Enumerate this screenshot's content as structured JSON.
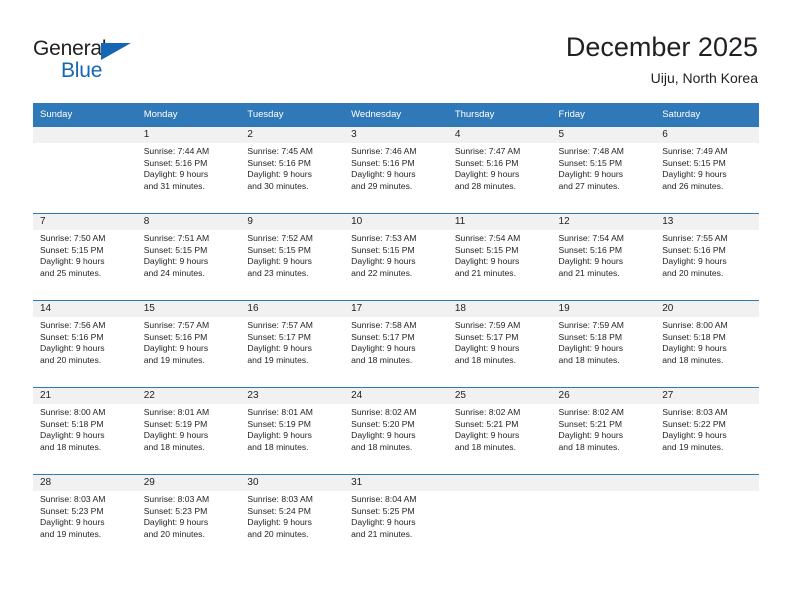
{
  "brand": {
    "name_part1": "General",
    "name_part2": "Blue",
    "accent_color": "#1567b5"
  },
  "header": {
    "title": "December 2025",
    "subtitle": "Uiju, North Korea"
  },
  "theme": {
    "header_row_color": "#3079b9",
    "daynum_band_color": "#f1f1f1",
    "text_color": "#231f20"
  },
  "weekday_headers": [
    "Sunday",
    "Monday",
    "Tuesday",
    "Wednesday",
    "Thursday",
    "Friday",
    "Saturday"
  ],
  "labels": {
    "sunrise_prefix": "Sunrise:",
    "sunset_prefix": "Sunset:",
    "daylight_prefix": "Daylight:"
  },
  "weeks": [
    [
      {
        "day": "",
        "sunrise": "",
        "sunset": "",
        "daylight_line1": "",
        "daylight_line2": ""
      },
      {
        "day": "1",
        "sunrise": "Sunrise: 7:44 AM",
        "sunset": "Sunset: 5:16 PM",
        "daylight_line1": "Daylight: 9 hours",
        "daylight_line2": "and 31 minutes."
      },
      {
        "day": "2",
        "sunrise": "Sunrise: 7:45 AM",
        "sunset": "Sunset: 5:16 PM",
        "daylight_line1": "Daylight: 9 hours",
        "daylight_line2": "and 30 minutes."
      },
      {
        "day": "3",
        "sunrise": "Sunrise: 7:46 AM",
        "sunset": "Sunset: 5:16 PM",
        "daylight_line1": "Daylight: 9 hours",
        "daylight_line2": "and 29 minutes."
      },
      {
        "day": "4",
        "sunrise": "Sunrise: 7:47 AM",
        "sunset": "Sunset: 5:16 PM",
        "daylight_line1": "Daylight: 9 hours",
        "daylight_line2": "and 28 minutes."
      },
      {
        "day": "5",
        "sunrise": "Sunrise: 7:48 AM",
        "sunset": "Sunset: 5:15 PM",
        "daylight_line1": "Daylight: 9 hours",
        "daylight_line2": "and 27 minutes."
      },
      {
        "day": "6",
        "sunrise": "Sunrise: 7:49 AM",
        "sunset": "Sunset: 5:15 PM",
        "daylight_line1": "Daylight: 9 hours",
        "daylight_line2": "and 26 minutes."
      }
    ],
    [
      {
        "day": "7",
        "sunrise": "Sunrise: 7:50 AM",
        "sunset": "Sunset: 5:15 PM",
        "daylight_line1": "Daylight: 9 hours",
        "daylight_line2": "and 25 minutes."
      },
      {
        "day": "8",
        "sunrise": "Sunrise: 7:51 AM",
        "sunset": "Sunset: 5:15 PM",
        "daylight_line1": "Daylight: 9 hours",
        "daylight_line2": "and 24 minutes."
      },
      {
        "day": "9",
        "sunrise": "Sunrise: 7:52 AM",
        "sunset": "Sunset: 5:15 PM",
        "daylight_line1": "Daylight: 9 hours",
        "daylight_line2": "and 23 minutes."
      },
      {
        "day": "10",
        "sunrise": "Sunrise: 7:53 AM",
        "sunset": "Sunset: 5:15 PM",
        "daylight_line1": "Daylight: 9 hours",
        "daylight_line2": "and 22 minutes."
      },
      {
        "day": "11",
        "sunrise": "Sunrise: 7:54 AM",
        "sunset": "Sunset: 5:15 PM",
        "daylight_line1": "Daylight: 9 hours",
        "daylight_line2": "and 21 minutes."
      },
      {
        "day": "12",
        "sunrise": "Sunrise: 7:54 AM",
        "sunset": "Sunset: 5:16 PM",
        "daylight_line1": "Daylight: 9 hours",
        "daylight_line2": "and 21 minutes."
      },
      {
        "day": "13",
        "sunrise": "Sunrise: 7:55 AM",
        "sunset": "Sunset: 5:16 PM",
        "daylight_line1": "Daylight: 9 hours",
        "daylight_line2": "and 20 minutes."
      }
    ],
    [
      {
        "day": "14",
        "sunrise": "Sunrise: 7:56 AM",
        "sunset": "Sunset: 5:16 PM",
        "daylight_line1": "Daylight: 9 hours",
        "daylight_line2": "and 20 minutes."
      },
      {
        "day": "15",
        "sunrise": "Sunrise: 7:57 AM",
        "sunset": "Sunset: 5:16 PM",
        "daylight_line1": "Daylight: 9 hours",
        "daylight_line2": "and 19 minutes."
      },
      {
        "day": "16",
        "sunrise": "Sunrise: 7:57 AM",
        "sunset": "Sunset: 5:17 PM",
        "daylight_line1": "Daylight: 9 hours",
        "daylight_line2": "and 19 minutes."
      },
      {
        "day": "17",
        "sunrise": "Sunrise: 7:58 AM",
        "sunset": "Sunset: 5:17 PM",
        "daylight_line1": "Daylight: 9 hours",
        "daylight_line2": "and 18 minutes."
      },
      {
        "day": "18",
        "sunrise": "Sunrise: 7:59 AM",
        "sunset": "Sunset: 5:17 PM",
        "daylight_line1": "Daylight: 9 hours",
        "daylight_line2": "and 18 minutes."
      },
      {
        "day": "19",
        "sunrise": "Sunrise: 7:59 AM",
        "sunset": "Sunset: 5:18 PM",
        "daylight_line1": "Daylight: 9 hours",
        "daylight_line2": "and 18 minutes."
      },
      {
        "day": "20",
        "sunrise": "Sunrise: 8:00 AM",
        "sunset": "Sunset: 5:18 PM",
        "daylight_line1": "Daylight: 9 hours",
        "daylight_line2": "and 18 minutes."
      }
    ],
    [
      {
        "day": "21",
        "sunrise": "Sunrise: 8:00 AM",
        "sunset": "Sunset: 5:18 PM",
        "daylight_line1": "Daylight: 9 hours",
        "daylight_line2": "and 18 minutes."
      },
      {
        "day": "22",
        "sunrise": "Sunrise: 8:01 AM",
        "sunset": "Sunset: 5:19 PM",
        "daylight_line1": "Daylight: 9 hours",
        "daylight_line2": "and 18 minutes."
      },
      {
        "day": "23",
        "sunrise": "Sunrise: 8:01 AM",
        "sunset": "Sunset: 5:19 PM",
        "daylight_line1": "Daylight: 9 hours",
        "daylight_line2": "and 18 minutes."
      },
      {
        "day": "24",
        "sunrise": "Sunrise: 8:02 AM",
        "sunset": "Sunset: 5:20 PM",
        "daylight_line1": "Daylight: 9 hours",
        "daylight_line2": "and 18 minutes."
      },
      {
        "day": "25",
        "sunrise": "Sunrise: 8:02 AM",
        "sunset": "Sunset: 5:21 PM",
        "daylight_line1": "Daylight: 9 hours",
        "daylight_line2": "and 18 minutes."
      },
      {
        "day": "26",
        "sunrise": "Sunrise: 8:02 AM",
        "sunset": "Sunset: 5:21 PM",
        "daylight_line1": "Daylight: 9 hours",
        "daylight_line2": "and 18 minutes."
      },
      {
        "day": "27",
        "sunrise": "Sunrise: 8:03 AM",
        "sunset": "Sunset: 5:22 PM",
        "daylight_line1": "Daylight: 9 hours",
        "daylight_line2": "and 19 minutes."
      }
    ],
    [
      {
        "day": "28",
        "sunrise": "Sunrise: 8:03 AM",
        "sunset": "Sunset: 5:23 PM",
        "daylight_line1": "Daylight: 9 hours",
        "daylight_line2": "and 19 minutes."
      },
      {
        "day": "29",
        "sunrise": "Sunrise: 8:03 AM",
        "sunset": "Sunset: 5:23 PM",
        "daylight_line1": "Daylight: 9 hours",
        "daylight_line2": "and 20 minutes."
      },
      {
        "day": "30",
        "sunrise": "Sunrise: 8:03 AM",
        "sunset": "Sunset: 5:24 PM",
        "daylight_line1": "Daylight: 9 hours",
        "daylight_line2": "and 20 minutes."
      },
      {
        "day": "31",
        "sunrise": "Sunrise: 8:04 AM",
        "sunset": "Sunset: 5:25 PM",
        "daylight_line1": "Daylight: 9 hours",
        "daylight_line2": "and 21 minutes."
      },
      {
        "day": "",
        "sunrise": "",
        "sunset": "",
        "daylight_line1": "",
        "daylight_line2": ""
      },
      {
        "day": "",
        "sunrise": "",
        "sunset": "",
        "daylight_line1": "",
        "daylight_line2": ""
      },
      {
        "day": "",
        "sunrise": "",
        "sunset": "",
        "daylight_line1": "",
        "daylight_line2": ""
      }
    ]
  ]
}
